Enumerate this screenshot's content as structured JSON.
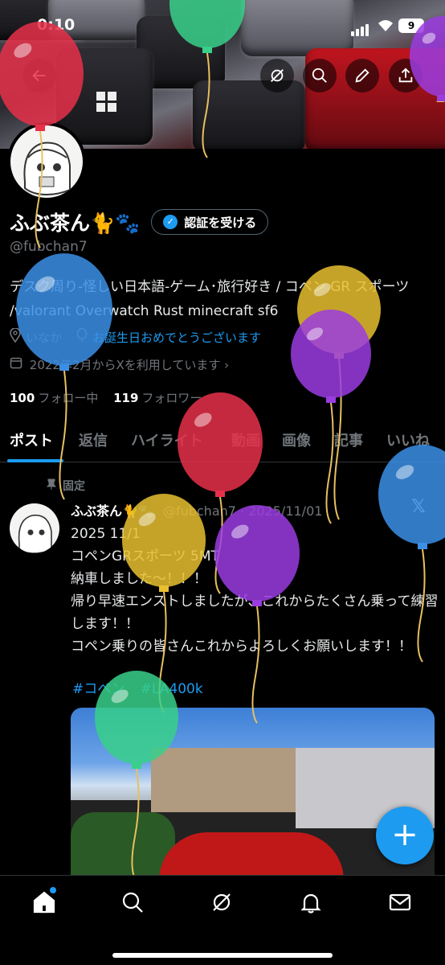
{
  "status_bar": {
    "time": "0:10",
    "battery": "9"
  },
  "profile": {
    "name": "ふぶ茶ん🐈🐾",
    "verify_label": "認証を受ける",
    "handle": "@fubchan7",
    "bio": "デスク周り-怪しい日本語-ゲーム･旅行好き / コペン GR スポーツ /valorant Overwatch Rust minecraft sf6",
    "location": "いなか",
    "birthday_link": "お誕生日おめでとうございます",
    "joined": "2022年2月からXを利用しています",
    "following_count": "100",
    "following_label": "フォロー中",
    "followers_count": "119",
    "followers_label": "フォロワー"
  },
  "tabs": [
    "ポスト",
    "返信",
    "ハイライト",
    "動画",
    "画像",
    "記事",
    "いいね"
  ],
  "pinned_label": "固定",
  "post": {
    "author": "ふぶ茶ん🐈🐾",
    "handle_date": "@fubchan7 · 2025/11/01",
    "body": "2025 11/1\nコペンGRスポーツ 5MT\n納車しました〜！！！\n帰り早速エンストしましたが、これからたくさん乗って練習します！！\nコペン乗りの皆さんこれからよろしくお願いします！！",
    "tags": [
      "#コペン",
      "#LA400k"
    ]
  },
  "fab_label": "+",
  "colors": {
    "accent": "#1d9bf0",
    "background": "#000000",
    "muted": "#71767b"
  },
  "balloon_colors": {
    "red": "#e8304a",
    "green": "#38d08a",
    "blue": "#3b8fe6",
    "yellow": "#e8c030",
    "purple": "#9a3ce0"
  }
}
